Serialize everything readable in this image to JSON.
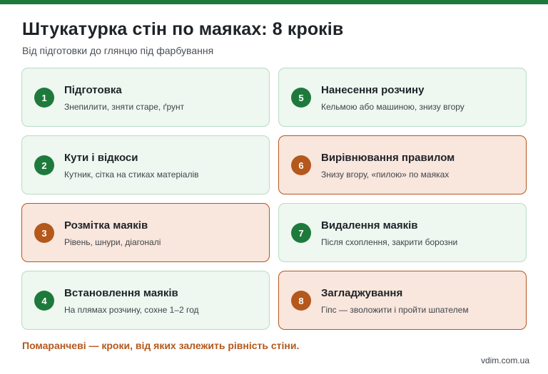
{
  "title": "Штукатурка стін по маяках: 8 кроків",
  "subtitle": "Від підготовки до глянцю під фарбування",
  "colors": {
    "primary": "#1e7a3c",
    "accent": "#b4581c"
  },
  "steps": [
    {
      "num": "1",
      "title": "Підготовка",
      "desc": "Знепилити, зняти старе, ґрунт",
      "critical": false
    },
    {
      "num": "2",
      "title": "Кути і відкоси",
      "desc": "Кутник, сітка на стиках матеріалів",
      "critical": false
    },
    {
      "num": "3",
      "title": "Розмітка маяків",
      "desc": "Рівень, шнури, діагоналі",
      "critical": true
    },
    {
      "num": "4",
      "title": "Встановлення маяків",
      "desc": "На плямах розчину, сохне 1–2 год",
      "critical": false
    },
    {
      "num": "5",
      "title": "Нанесення розчину",
      "desc": "Кельмою або машиною, знизу вгору",
      "critical": false
    },
    {
      "num": "6",
      "title": "Вирівнювання правилом",
      "desc": "Знизу вгору, «пилою» по маяках",
      "critical": true
    },
    {
      "num": "7",
      "title": "Видалення маяків",
      "desc": "Після схоплення, закрити борозни",
      "critical": false
    },
    {
      "num": "8",
      "title": "Загладжування",
      "desc": "Гіпс — зволожити і пройти шпателем",
      "critical": true
    }
  ],
  "note": "Помаранчеві — кроки, від яких залежить рівність стіни.",
  "site": "vdim.com.ua"
}
